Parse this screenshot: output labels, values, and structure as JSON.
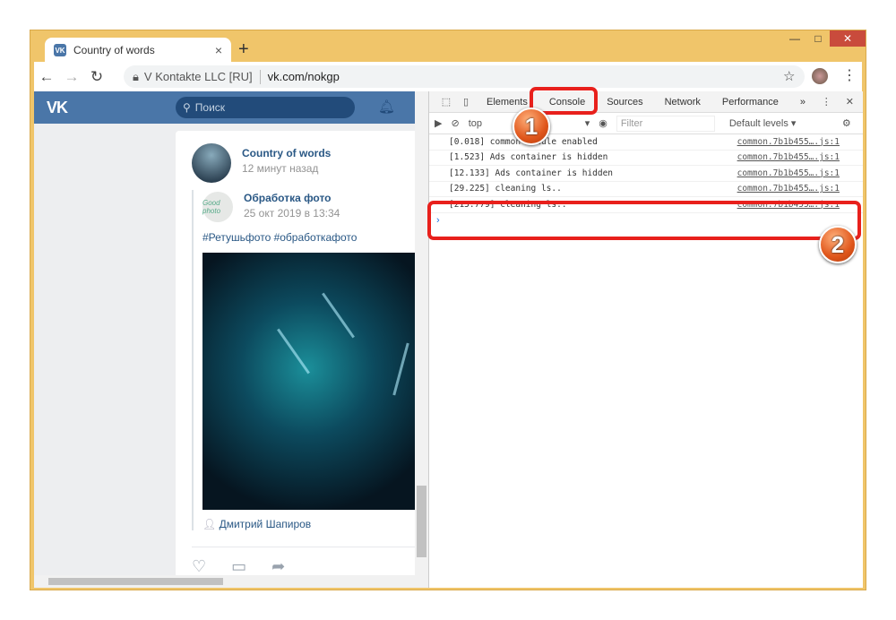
{
  "browser": {
    "tab_title": "Country of words",
    "favicon": "VK",
    "new_tab": "+",
    "site_identity": "V Kontakte LLC [RU]",
    "url": "vk.com/nokgp",
    "min": "—",
    "max": "□",
    "close": "✕"
  },
  "vk": {
    "logo": "VK",
    "search_placeholder": "Поиск",
    "post": {
      "author": "Country of words",
      "time": "12 минут назад",
      "repost": {
        "author": "Обработка фото",
        "date": "25 окт 2019 в 13:34",
        "avatar_text": "Good photo",
        "tags": "#Ретушьфото #обработкафото",
        "signer": "Дмитрий Шапиров"
      }
    }
  },
  "devtools": {
    "tabs": [
      "Elements",
      "Console",
      "Sources",
      "Network",
      "Performance"
    ],
    "active_tab": "Console",
    "more": "»",
    "context": "top",
    "filter_placeholder": "Filter",
    "levels": "Default levels ▾",
    "logs": [
      {
        "text": "[0.018]  common module enabled",
        "src": "common.7b1b455….js:1"
      },
      {
        "text": "[1.523]  Ads container is hidden",
        "src": "common.7b1b455….js:1"
      },
      {
        "text": "[12.133]  Ads container is hidden",
        "src": "common.7b1b455….js:1"
      },
      {
        "text": "[29.225]  cleaning ls..",
        "src": "common.7b1b455….js:1"
      },
      {
        "text": "[215.779]  cleaning ls..",
        "src": "common.7b1b455….js:1"
      }
    ],
    "prompt": "›"
  },
  "annotations": {
    "step1": "1",
    "step2": "2"
  }
}
